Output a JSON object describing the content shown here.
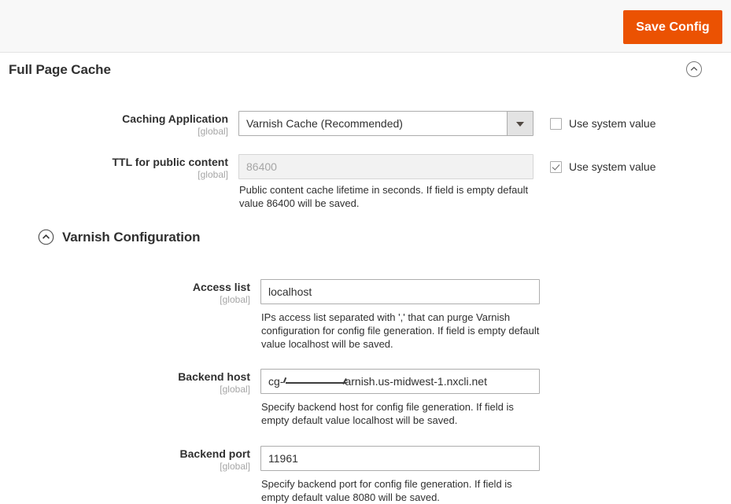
{
  "toolbar": {
    "save_label": "Save Config"
  },
  "section": {
    "title": "Full Page Cache",
    "collapse_icon": "chevron-up-circle-icon"
  },
  "fields": [
    {
      "label": "Caching Application",
      "scope": "[global]",
      "type": "select",
      "value": "Varnish Cache (Recommended)",
      "use_system_value": {
        "label": "Use system value",
        "checked": false
      }
    },
    {
      "label": "TTL for public content",
      "scope": "[global]",
      "type": "text",
      "value": "86400",
      "disabled": true,
      "note": "Public content cache lifetime in seconds. If field is empty default value 86400 will be saved.",
      "use_system_value": {
        "label": "Use system value",
        "checked": true
      }
    }
  ],
  "subsection": {
    "title": "Varnish Configuration",
    "collapse_icon": "chevron-up-circle-icon",
    "fields": [
      {
        "label": "Access list",
        "scope": "[global]",
        "type": "text",
        "value": "localhost",
        "note": "IPs access list separated with ',' that can purge Varnish configuration for config file generation. If field is empty default value localhost will be saved."
      },
      {
        "label": "Backend host",
        "scope": "[global]",
        "type": "text",
        "value_prefix": "cg-",
        "value_suffix": "arnish.us-midwest-1.nxcli.net",
        "redacted": true,
        "note": "Specify backend host for config file generation. If field is empty default value localhost will be saved."
      },
      {
        "label": "Backend port",
        "scope": "[global]",
        "type": "text",
        "value": "11961",
        "note": "Specify backend port for config file generation. If field is empty default value 8080 will be saved."
      }
    ]
  },
  "colors": {
    "accent": "#eb5202",
    "toolbar_bg": "#f8f8f8",
    "border": "#adadad",
    "text": "#303030",
    "muted": "#a6a6a6"
  }
}
